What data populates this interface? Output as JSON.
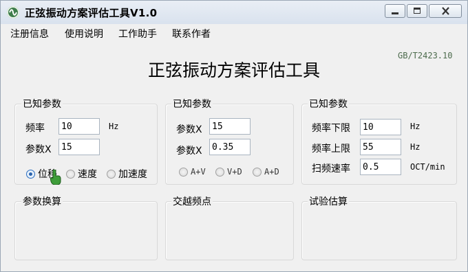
{
  "window": {
    "title": "正弦振动方案评估工具V1.0"
  },
  "menu": [
    "注册信息",
    "使用说明",
    "工作助手",
    "联系作者"
  ],
  "header": {
    "title": "正弦振动方案评估工具",
    "standard": "GB/T2423.10"
  },
  "panel1": {
    "title": "已知参数",
    "freq_label": "频率",
    "freq_value": "10",
    "freq_unit": "Hz",
    "paramx_label": "参数X",
    "paramx_value": "15",
    "radios": [
      "位移",
      "速度",
      "加速度"
    ],
    "selected": "位移"
  },
  "panel2": {
    "title": "已知参数",
    "p1_label": "参数X",
    "p1_value": "15",
    "p2_label": "参数X",
    "p2_value": "0.35",
    "radios": [
      "A+V",
      "V+D",
      "A+D"
    ]
  },
  "panel3": {
    "title": "已知参数",
    "fmin_label": "频率下限",
    "fmin_value": "10",
    "fmin_unit": "Hz",
    "fmax_label": "频率上限",
    "fmax_value": "55",
    "fmax_unit": "Hz",
    "sweep_label": "扫频速率",
    "sweep_value": "0.5",
    "sweep_unit": "OCT/min"
  },
  "results": [
    "参数换算",
    "交越频点",
    "试验估算"
  ],
  "colors": {
    "accent": "#2a63ad",
    "titlebar": "#dde5ee",
    "background": "#f0f0f0"
  }
}
